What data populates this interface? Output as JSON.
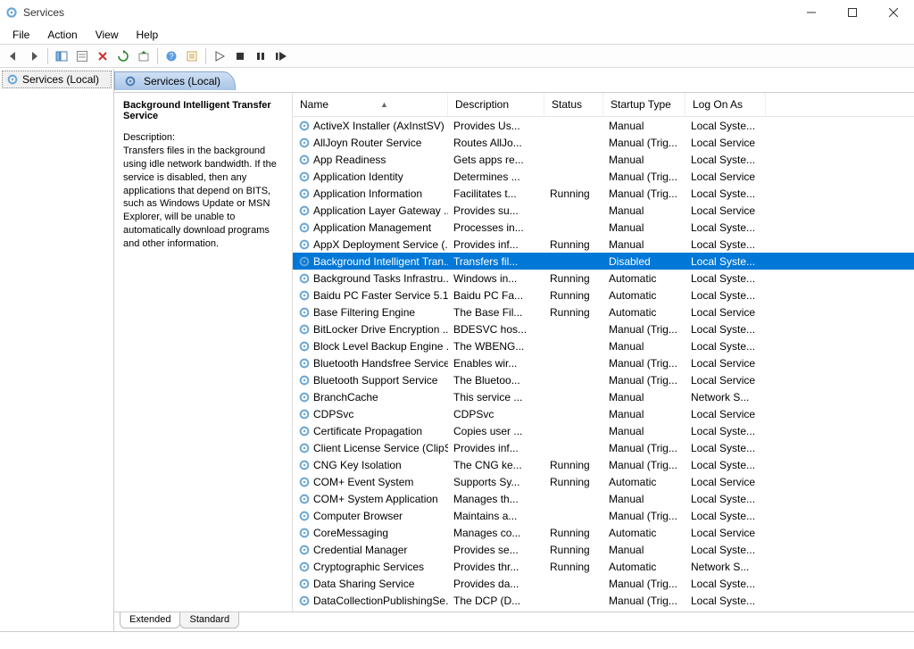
{
  "window": {
    "title": "Services"
  },
  "menu": {
    "items": [
      "File",
      "Action",
      "View",
      "Help"
    ]
  },
  "tree": {
    "root": "Services (Local)"
  },
  "pane": {
    "heading": "Services (Local)"
  },
  "details": {
    "name": "Background Intelligent Transfer Service",
    "desc_label": "Description:",
    "desc": "Transfers files in the background using idle network bandwidth. If the service is disabled, then any applications that depend on BITS, such as Windows Update or MSN Explorer, will be unable to automatically download programs and other information."
  },
  "columns": {
    "name": "Name",
    "desc": "Description",
    "status": "Status",
    "start": "Startup Type",
    "logon": "Log On As"
  },
  "tabs": {
    "extended": "Extended",
    "standard": "Standard"
  },
  "services": [
    {
      "name": "ActiveX Installer (AxInstSV)",
      "desc": "Provides Us...",
      "status": "",
      "start": "Manual",
      "logon": "Local Syste..."
    },
    {
      "name": "AllJoyn Router Service",
      "desc": "Routes AllJo...",
      "status": "",
      "start": "Manual (Trig...",
      "logon": "Local Service"
    },
    {
      "name": "App Readiness",
      "desc": "Gets apps re...",
      "status": "",
      "start": "Manual",
      "logon": "Local Syste..."
    },
    {
      "name": "Application Identity",
      "desc": "Determines ...",
      "status": "",
      "start": "Manual (Trig...",
      "logon": "Local Service"
    },
    {
      "name": "Application Information",
      "desc": "Facilitates t...",
      "status": "Running",
      "start": "Manual (Trig...",
      "logon": "Local Syste..."
    },
    {
      "name": "Application Layer Gateway ...",
      "desc": "Provides su...",
      "status": "",
      "start": "Manual",
      "logon": "Local Service"
    },
    {
      "name": "Application Management",
      "desc": "Processes in...",
      "status": "",
      "start": "Manual",
      "logon": "Local Syste..."
    },
    {
      "name": "AppX Deployment Service (...",
      "desc": "Provides inf...",
      "status": "Running",
      "start": "Manual",
      "logon": "Local Syste..."
    },
    {
      "name": "Background Intelligent Tran...",
      "desc": "Transfers fil...",
      "status": "",
      "start": "Disabled",
      "logon": "Local Syste...",
      "selected": true
    },
    {
      "name": "Background Tasks Infrastru...",
      "desc": "Windows in...",
      "status": "Running",
      "start": "Automatic",
      "logon": "Local Syste..."
    },
    {
      "name": "Baidu PC Faster Service 5.1....",
      "desc": "Baidu PC Fa...",
      "status": "Running",
      "start": "Automatic",
      "logon": "Local Syste..."
    },
    {
      "name": "Base Filtering Engine",
      "desc": "The Base Fil...",
      "status": "Running",
      "start": "Automatic",
      "logon": "Local Service"
    },
    {
      "name": "BitLocker Drive Encryption ...",
      "desc": "BDESVC hos...",
      "status": "",
      "start": "Manual (Trig...",
      "logon": "Local Syste..."
    },
    {
      "name": "Block Level Backup Engine ...",
      "desc": "The WBENG...",
      "status": "",
      "start": "Manual",
      "logon": "Local Syste..."
    },
    {
      "name": "Bluetooth Handsfree Service",
      "desc": "Enables wir...",
      "status": "",
      "start": "Manual (Trig...",
      "logon": "Local Service"
    },
    {
      "name": "Bluetooth Support Service",
      "desc": "The Bluetoo...",
      "status": "",
      "start": "Manual (Trig...",
      "logon": "Local Service"
    },
    {
      "name": "BranchCache",
      "desc": "This service ...",
      "status": "",
      "start": "Manual",
      "logon": "Network S..."
    },
    {
      "name": "CDPSvc",
      "desc": "CDPSvc",
      "status": "",
      "start": "Manual",
      "logon": "Local Service"
    },
    {
      "name": "Certificate Propagation",
      "desc": "Copies user ...",
      "status": "",
      "start": "Manual",
      "logon": "Local Syste..."
    },
    {
      "name": "Client License Service (ClipS...",
      "desc": "Provides inf...",
      "status": "",
      "start": "Manual (Trig...",
      "logon": "Local Syste..."
    },
    {
      "name": "CNG Key Isolation",
      "desc": "The CNG ke...",
      "status": "Running",
      "start": "Manual (Trig...",
      "logon": "Local Syste..."
    },
    {
      "name": "COM+ Event System",
      "desc": "Supports Sy...",
      "status": "Running",
      "start": "Automatic",
      "logon": "Local Service"
    },
    {
      "name": "COM+ System Application",
      "desc": "Manages th...",
      "status": "",
      "start": "Manual",
      "logon": "Local Syste..."
    },
    {
      "name": "Computer Browser",
      "desc": "Maintains a...",
      "status": "",
      "start": "Manual (Trig...",
      "logon": "Local Syste..."
    },
    {
      "name": "CoreMessaging",
      "desc": "Manages co...",
      "status": "Running",
      "start": "Automatic",
      "logon": "Local Service"
    },
    {
      "name": "Credential Manager",
      "desc": "Provides se...",
      "status": "Running",
      "start": "Manual",
      "logon": "Local Syste..."
    },
    {
      "name": "Cryptographic Services",
      "desc": "Provides thr...",
      "status": "Running",
      "start": "Automatic",
      "logon": "Network S..."
    },
    {
      "name": "Data Sharing Service",
      "desc": "Provides da...",
      "status": "",
      "start": "Manual (Trig...",
      "logon": "Local Syste..."
    },
    {
      "name": "DataCollectionPublishingSe...",
      "desc": "The DCP (D...",
      "status": "",
      "start": "Manual (Trig...",
      "logon": "Local Syste..."
    }
  ]
}
